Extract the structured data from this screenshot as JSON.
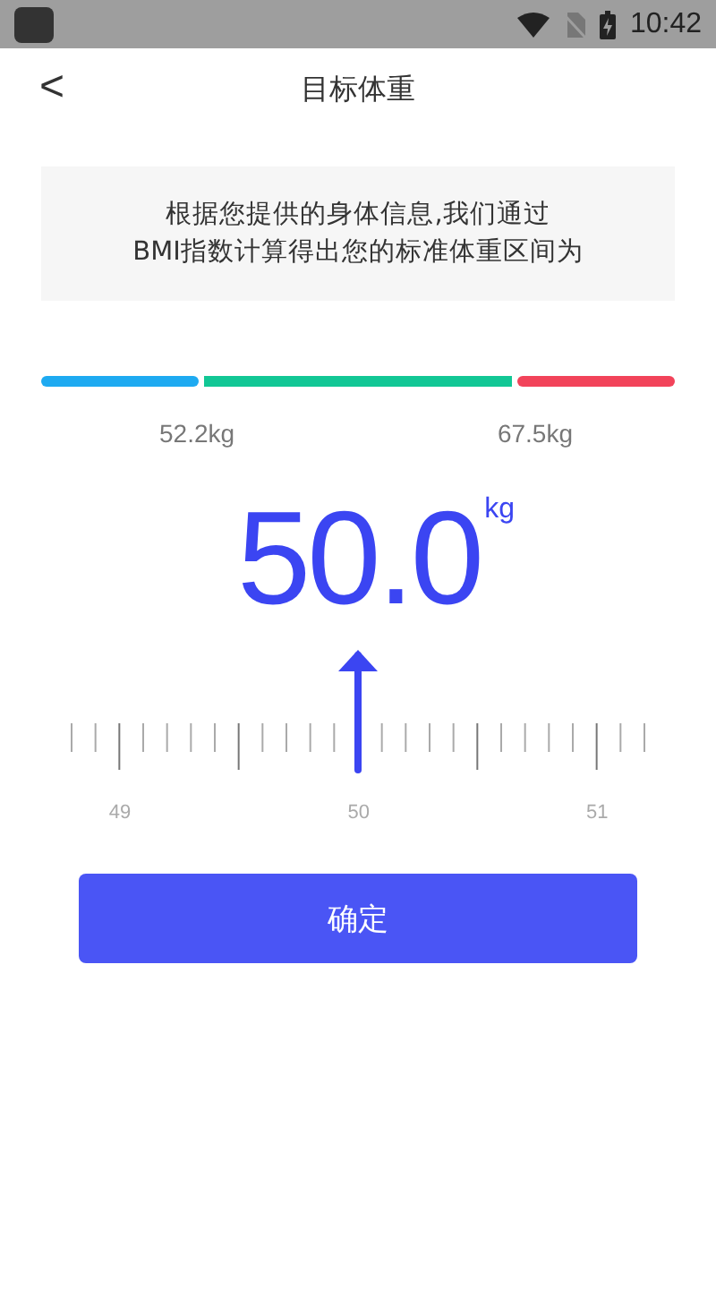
{
  "status_bar": {
    "time": "10:42"
  },
  "header": {
    "back": "<",
    "title": "目标体重"
  },
  "info": {
    "text": "根据您提供的身体信息,我们通过\nBMI指数计算得出您的标准体重区间为"
  },
  "range_bar": {
    "segments": [
      {
        "color": "#1eaaf1"
      },
      {
        "color": "#12c795"
      },
      {
        "color": "#f2435a"
      }
    ],
    "labels": [
      "52.2kg",
      "67.5kg"
    ]
  },
  "weight": {
    "value": "50.0",
    "unit": "kg"
  },
  "ruler": {
    "labels": [
      "49",
      "50",
      "51"
    ]
  },
  "confirm_button": {
    "label": "确定"
  }
}
